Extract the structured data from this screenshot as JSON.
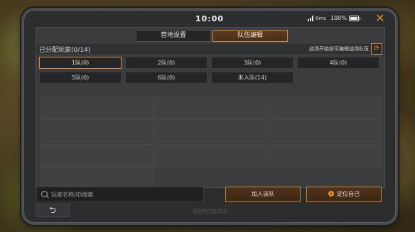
{
  "status": {
    "time": "10:00",
    "ping": "6ms",
    "battery": "100%"
  },
  "icons": {
    "close": "close-icon",
    "refresh": "refresh-icon",
    "search": "search-icon",
    "locate": "locate-icon",
    "back": "back-icon"
  },
  "tabs": [
    {
      "label": "营地设置",
      "active": false
    },
    {
      "label": "队伍编辑",
      "active": true
    }
  ],
  "header": {
    "assigned": "已分配玩家(0/14)",
    "note": "战场开始前可编辑战场队伍"
  },
  "teams": [
    {
      "label": "1队(0)",
      "selected": true
    },
    {
      "label": "2队(0)",
      "selected": false
    },
    {
      "label": "3队(0)",
      "selected": false
    },
    {
      "label": "4队(0)",
      "selected": false
    },
    {
      "label": "5队(0)",
      "selected": false
    },
    {
      "label": "6队(0)",
      "selected": false
    },
    {
      "label": "未入队(14)",
      "selected": false
    }
  ],
  "search": {
    "placeholder": "玩家名称/ID搜索",
    "value": ""
  },
  "actions": {
    "join": "加入该队",
    "locate": "定位自己"
  },
  "back_label": "⮌",
  "hint": "点击空白处关闭",
  "colors": {
    "accent": "#e0892d",
    "panel": "#3a3c3e"
  }
}
